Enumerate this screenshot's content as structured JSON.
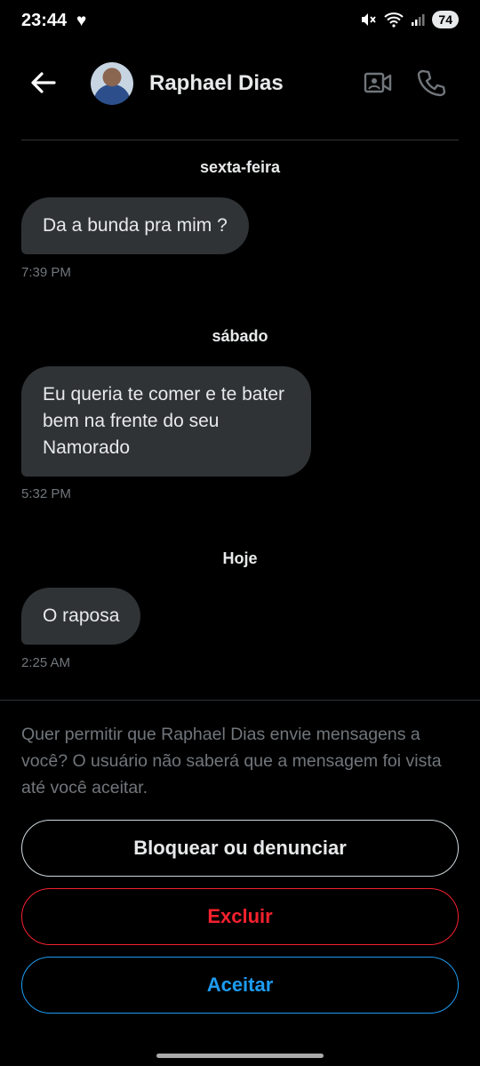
{
  "status": {
    "time": "23:44",
    "battery": "74"
  },
  "header": {
    "name": "Raphael Dias"
  },
  "messages": [
    {
      "day": "sexta-feira",
      "text": "Da a bunda pra mim ?",
      "time": "7:39 PM"
    },
    {
      "day": "sábado",
      "text": "Eu queria te comer e te bater bem na frente do seu Namorado",
      "time": "5:32 PM"
    },
    {
      "day": "Hoje",
      "text": "O raposa",
      "time": "2:25 AM"
    }
  ],
  "request": {
    "text": "Quer permitir que Raphael Dias envie mensagens a você? O usuário não saberá que a mensagem foi vista até você aceitar.",
    "block_label": "Bloquear ou denunciar",
    "delete_label": "Excluir",
    "accept_label": "Aceitar"
  },
  "colors": {
    "accent": "#1d9bf0",
    "danger": "#f4212e",
    "bubble": "#2f3336",
    "muted": "#71767b"
  },
  "icons": [
    "heart-icon",
    "mute-icon",
    "wifi-icon",
    "signal-icon",
    "back-arrow-icon",
    "video-call-icon",
    "phone-icon"
  ]
}
